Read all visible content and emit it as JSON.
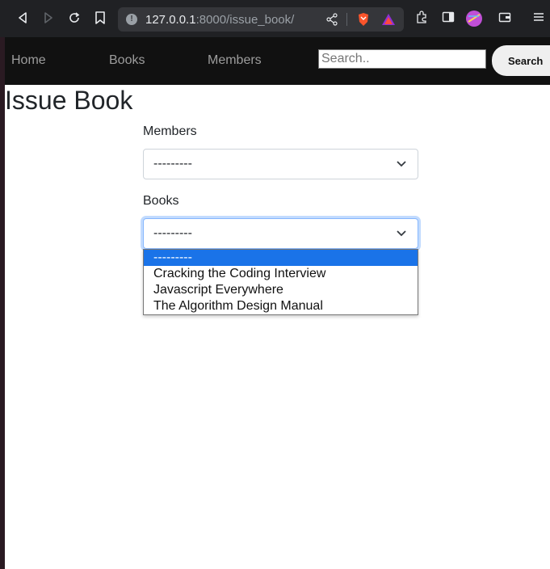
{
  "browser": {
    "url_host": "127.0.0.1",
    "url_path": ":8000/issue_book/"
  },
  "navbar": {
    "links": [
      "Home",
      "Books",
      "Members"
    ],
    "search_placeholder": "Search..",
    "search_button": "Search"
  },
  "page": {
    "title": "Issue Book"
  },
  "form": {
    "members_label": "Members",
    "members_value": "---------",
    "books_label": "Books",
    "books_value": "---------",
    "books_options": [
      "---------",
      "Cracking the Coding Interview",
      "Javascript Everywhere",
      "The Algorithm Design Manual"
    ],
    "books_selected_index": 0
  },
  "colors": {
    "navbar_bg": "#111111",
    "selected_option_bg": "#1a73e8",
    "focus_border": "#86b7fe"
  }
}
